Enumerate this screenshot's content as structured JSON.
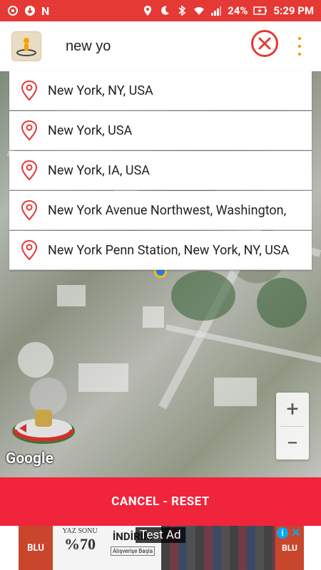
{
  "status_bar": {
    "battery": "24%",
    "time": "5:29 PM"
  },
  "search": {
    "value": "new yo"
  },
  "suggestions": [
    "New York, NY, USA",
    "New York, USA",
    "New York, IA, USA",
    "New York Avenue Northwest, Washington,",
    "New York Penn Station, New York, NY, USA"
  ],
  "map": {
    "google_logo": "Google",
    "zoom_in": "+",
    "zoom_out": "−"
  },
  "action": {
    "cancel_reset_label": "CANCEL - RESET"
  },
  "ad": {
    "badge": "Test Ad",
    "brand_left": "BLU",
    "brand_right": "BLU",
    "sale_line1": "YAZ SONU",
    "sale_percent": "%70",
    "discount": "İNDİRİM",
    "cta": "Alışverişe Başla",
    "adchoice": "i",
    "close": "✕"
  },
  "colors": {
    "accent": "#e53935",
    "action_bar": "#f0243a",
    "menu_dots": "#ff8f00"
  }
}
